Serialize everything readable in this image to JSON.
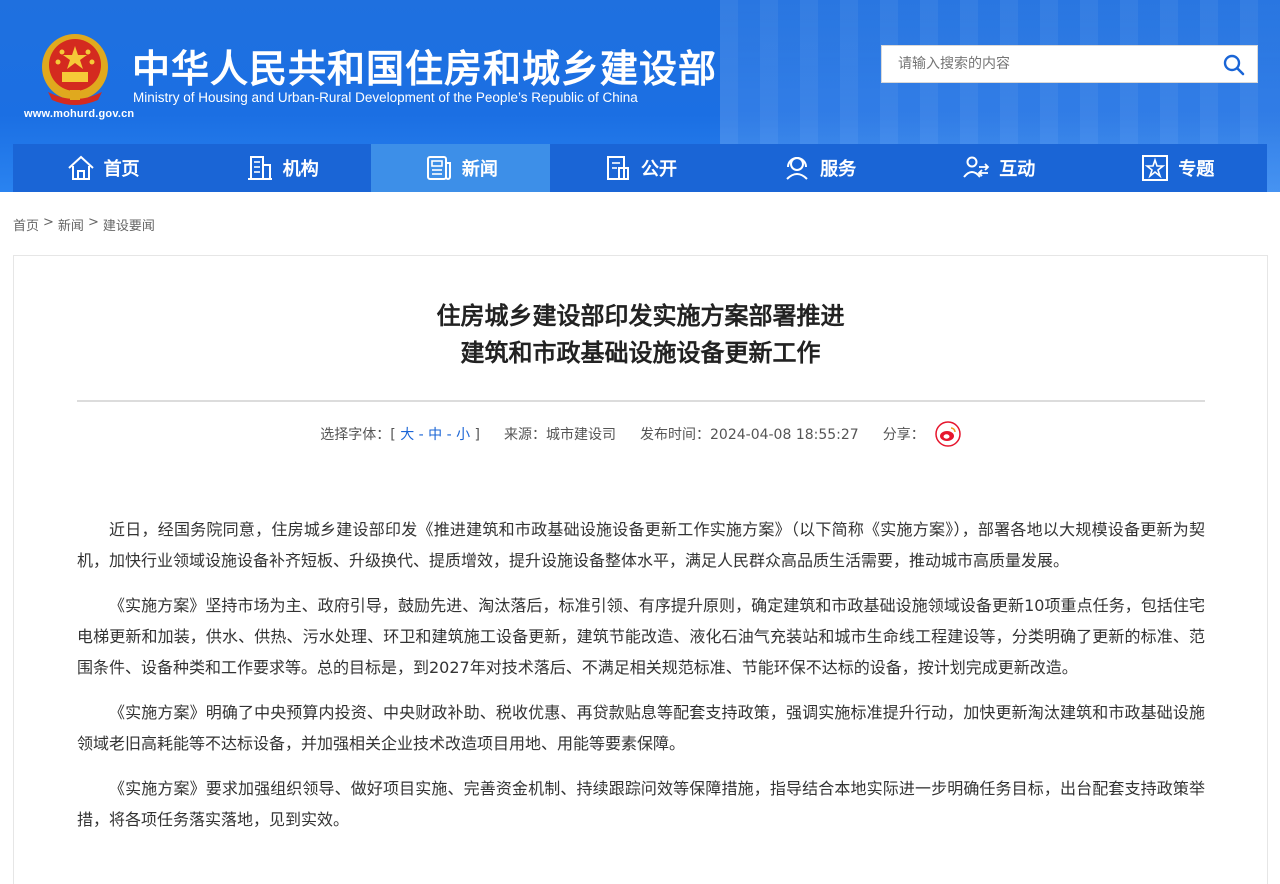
{
  "header": {
    "title": "中华人民共和国住房和城乡建设部",
    "subtitle": "Ministry of Housing and Urban-Rural Development of the People’s Republic of China",
    "url": "www.mohurd.gov.cn",
    "search_placeholder": "请输入搜索的内容"
  },
  "nav": [
    {
      "label": "首页",
      "icon": "home-icon"
    },
    {
      "label": "机构",
      "icon": "building-icon"
    },
    {
      "label": "新闻",
      "icon": "newspaper-icon"
    },
    {
      "label": "公开",
      "icon": "document-icon"
    },
    {
      "label": "服务",
      "icon": "service-icon"
    },
    {
      "label": "互动",
      "icon": "interaction-icon"
    },
    {
      "label": "专题",
      "icon": "star-icon"
    }
  ],
  "breadcrumb": [
    "首页",
    "新闻",
    "建设要闻"
  ],
  "article": {
    "title_line1": "住房城乡建设部印发实施方案部署推进",
    "title_line2": "建筑和市政基础设施设备更新工作",
    "font_label": "选择字体：",
    "font_large": "大",
    "font_medium": "中",
    "font_small": "小",
    "source": "来源：城市建设司",
    "publish_time": "发布时间：2024-04-08 18:55:27",
    "share_label": "分享：",
    "paragraphs": [
      "近日，经国务院同意，住房城乡建设部印发《推进建筑和市政基础设施设备更新工作实施方案》（以下简称《实施方案》），部署各地以大规模设备更新为契机，加快行业领域设施设备补齐短板、升级换代、提质增效，提升设施设备整体水平，满足人民群众高品质生活需要，推动城市高质量发展。",
      "《实施方案》坚持市场为主、政府引导，鼓励先进、淘汰落后，标准引领、有序提升原则，确定建筑和市政基础设施领域设备更新10项重点任务，包括住宅电梯更新和加装，供水、供热、污水处理、环卫和建筑施工设备更新，建筑节能改造、液化石油气充装站和城市生命线工程建设等，分类明确了更新的标准、范围条件、设备种类和工作要求等。总的目标是，到2027年对技术落后、不满足相关规范标准、节能环保不达标的设备，按计划完成更新改造。",
      "《实施方案》明确了中央预算内投资、中央财政补助、税收优惠、再贷款贴息等配套支持政策，强调实施标准提升行动，加快更新淘汰建筑和市政基础设施领域老旧高耗能等不达标设备，并加强相关企业技术改造项目用地、用能等要素保障。",
      "《实施方案》要求加强组织领导、做好项目实施、完善资金机制、持续跟踪问效等保障措施，指导结合本地实际进一步明确任务目标，出台配套支持政策举措，将各项任务落实落地，见到实效。"
    ]
  },
  "colors": {
    "header_blue": "#1f70df",
    "nav_blue": "#1a65d6",
    "nav_active": "#3d8fe8",
    "weibo_red": "#e6162d"
  }
}
